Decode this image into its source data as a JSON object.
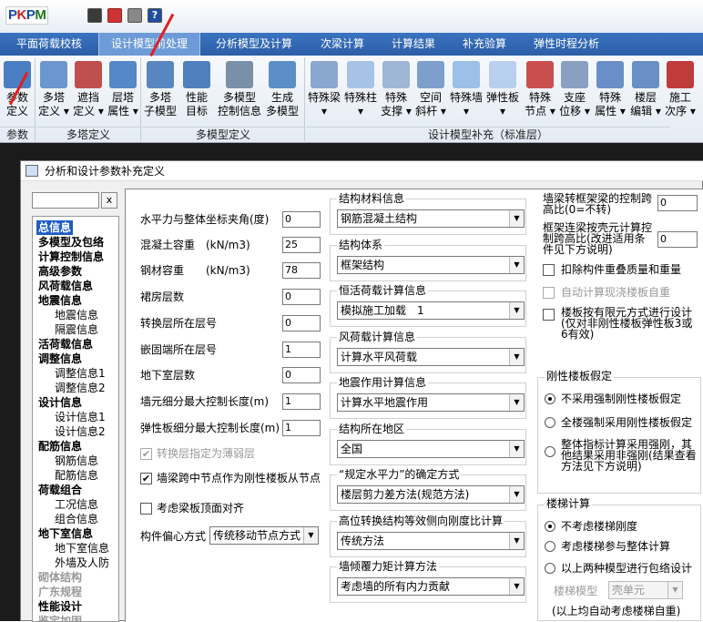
{
  "app": {
    "logo": "PKPM"
  },
  "ribbon_tabs": [
    "平面荷载校核",
    "设计模型前处理",
    "分析模型及计算",
    "次梁计算",
    "计算结果",
    "补充验算",
    "弹性时程分析"
  ],
  "ribbon": {
    "buttons": [
      {
        "l1": "参数",
        "l2": "定义"
      },
      {
        "l1": "多塔",
        "l2": "定义 ▾"
      },
      {
        "l1": "遮挡",
        "l2": "定义 ▾"
      },
      {
        "l1": "层塔",
        "l2": "属性 ▾"
      },
      {
        "l1": "多塔",
        "l2": "子模型"
      },
      {
        "l1": "性能",
        "l2": "目标"
      },
      {
        "l1": "多模型",
        "l2": "控制信息"
      },
      {
        "l1": "生成",
        "l2": "多模型"
      },
      {
        "l1": "特殊梁",
        "l2": "▾"
      },
      {
        "l1": "特殊柱",
        "l2": "▾"
      },
      {
        "l1": "特殊",
        "l2": "支撑 ▾"
      },
      {
        "l1": "空间",
        "l2": "斜杆 ▾"
      },
      {
        "l1": "特殊墙",
        "l2": "▾"
      },
      {
        "l1": "弹性板",
        "l2": "▾"
      },
      {
        "l1": "特殊",
        "l2": "节点 ▾"
      },
      {
        "l1": "支座",
        "l2": "位移 ▾"
      },
      {
        "l1": "特殊",
        "l2": "属性 ▾"
      },
      {
        "l1": "楼层",
        "l2": "编辑 ▾"
      },
      {
        "l1": "施工",
        "l2": "次序 ▾"
      }
    ],
    "groups": [
      "参数",
      "多塔定义",
      "多模型定义",
      "设计模型补充（标准层）"
    ]
  },
  "dialog": {
    "title": "分析和设计参数补充定义",
    "search_close": "x",
    "tree": [
      {
        "t": "总信息",
        "c": "b sel"
      },
      {
        "t": "多模型及包络",
        "c": "b"
      },
      {
        "t": "计算控制信息",
        "c": "b"
      },
      {
        "t": "高级参数",
        "c": "b"
      },
      {
        "t": "风荷载信息",
        "c": "b"
      },
      {
        "t": "地震信息",
        "c": "b"
      },
      {
        "t": "地震信息",
        "c": "s"
      },
      {
        "t": "隔震信息",
        "c": "s"
      },
      {
        "t": "活荷载信息",
        "c": "b"
      },
      {
        "t": "调整信息",
        "c": "b"
      },
      {
        "t": "调整信息1",
        "c": "s"
      },
      {
        "t": "调整信息2",
        "c": "s"
      },
      {
        "t": "设计信息",
        "c": "b"
      },
      {
        "t": "设计信息1",
        "c": "s"
      },
      {
        "t": "设计信息2",
        "c": "s"
      },
      {
        "t": "配筋信息",
        "c": "b"
      },
      {
        "t": "钢筋信息",
        "c": "s"
      },
      {
        "t": "配筋信息",
        "c": "s"
      },
      {
        "t": "荷载组合",
        "c": "b"
      },
      {
        "t": "工况信息",
        "c": "s"
      },
      {
        "t": "组合信息",
        "c": "s"
      },
      {
        "t": "地下室信息",
        "c": "b"
      },
      {
        "t": "地下室信息",
        "c": "s"
      },
      {
        "t": "外墙及人防",
        "c": "s"
      },
      {
        "t": "砌体结构",
        "c": "b g"
      },
      {
        "t": "广东规程",
        "c": "b g"
      },
      {
        "t": "性能设计",
        "c": "b"
      },
      {
        "t": "鉴定加固",
        "c": "b g"
      }
    ],
    "left_fields": [
      {
        "label": "水平力与整体坐标夹角(度)",
        "value": "0"
      },
      {
        "label": "混凝土容重　(kN/m3)",
        "value": "25"
      },
      {
        "label": "钢材容重　　(kN/m3)",
        "value": "78"
      },
      {
        "label": "裙房层数",
        "value": "0"
      },
      {
        "label": "转换层所在层号",
        "value": "0"
      },
      {
        "label": "嵌固端所在层号",
        "value": "1"
      },
      {
        "label": "地下室层数",
        "value": "0"
      },
      {
        "label": "墙元细分最大控制长度(m)",
        "value": "1"
      },
      {
        "label": "弹性板细分最大控制长度(m)",
        "value": "1"
      }
    ],
    "left_checks": [
      {
        "label": "转换层指定为薄弱层",
        "checked": true,
        "disabled": true
      },
      {
        "label": "墙梁跨中节点作为刚性楼板从节点",
        "checked": true,
        "disabled": false
      },
      {
        "label": "考虑梁板顶面对齐",
        "checked": false,
        "disabled": false
      }
    ],
    "eccentric": {
      "label": "构件偏心方式",
      "value": "传统移动节点方式"
    },
    "mid_groups": [
      {
        "title": "结构材料信息",
        "value": "钢筋混凝土结构"
      },
      {
        "title": "结构体系",
        "value": "框架结构"
      },
      {
        "title": "恒活荷载计算信息",
        "value": "模拟施工加载　1"
      },
      {
        "title": "风荷载计算信息",
        "value": "计算水平风荷载"
      },
      {
        "title": "地震作用计算信息",
        "value": "计算水平地震作用"
      },
      {
        "title": "结构所在地区",
        "value": "全国"
      },
      {
        "title": "“规定水平力”的确定方式",
        "value": "楼层剪力差方法(规范方法)"
      },
      {
        "title": "高位转换结构等效侧向刚度比计算",
        "value": "传统方法"
      },
      {
        "title": "墙倾覆力矩计算方法",
        "value": "考虑墙的所有内力贡献"
      }
    ],
    "right": {
      "f1_label": "墙梁转框架梁的控制跨高比(0=不转)",
      "f1_value": "0",
      "f2_label": "框架连梁按壳元计算控制跨高比(改进适用条件见下方说明)",
      "f2_value": "0",
      "c1": "扣除构件重叠质量和重量",
      "c2": "自动计算现浇楼板自重",
      "c3": "楼板按有限元方式进行设计(仅对非刚性楼板弹性板3或6有效)",
      "rigid_title": "刚性楼板假定",
      "rigid_opts": [
        "不采用强制刚性楼板假定",
        "全楼强制采用刚性楼板假定",
        "整体指标计算采用强刚，其他结果采用非强刚(结果查看方法见下方说明)"
      ],
      "stair_title": "楼梯计算",
      "stair_opts": [
        "不考虑楼梯刚度",
        "考虑楼梯参与整体计算",
        "以上两种模型进行包络设计"
      ],
      "stair_model_label": "楼梯模型",
      "stair_model_value": "壳单元",
      "stair_note": "(以上均自动考虑楼梯自重)"
    }
  }
}
